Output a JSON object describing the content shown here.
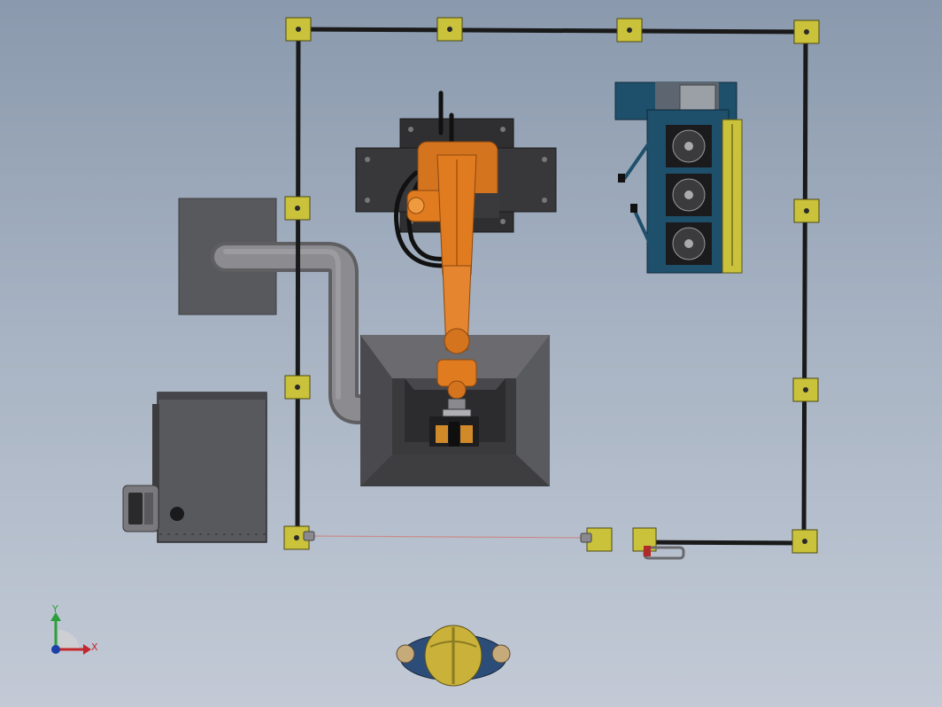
{
  "viewport": {
    "background_top": "#8a99ad",
    "background_bottom": "#c3cad6"
  },
  "triad": {
    "x_label": "X",
    "y_label": "Y",
    "x_color": "#c1272d",
    "y_color": "#2e9e3a",
    "z_color": "#1c3fa8"
  },
  "colors": {
    "fence_post": "#c9c23a",
    "fence_rail": "#1a1a1a",
    "robot": "#e07b20",
    "robot_base": "#2f2f31",
    "hood": "#5a5a5d",
    "duct": "#7f7f82",
    "station_panel": "#1e4f6b",
    "station_rail": "#c9c23a",
    "control_cabinet": "#58595c",
    "light_curtain": "#c98a8a",
    "operator_helmet": "#c9b13a",
    "operator_body": "#2c4d78"
  },
  "components": [
    "safety-fence",
    "industrial-robot",
    "welding-exhaust-hood",
    "exhaust-duct",
    "fume-extractor-unit",
    "control-cabinet",
    "workpiece-station",
    "light-curtain",
    "operator"
  ]
}
